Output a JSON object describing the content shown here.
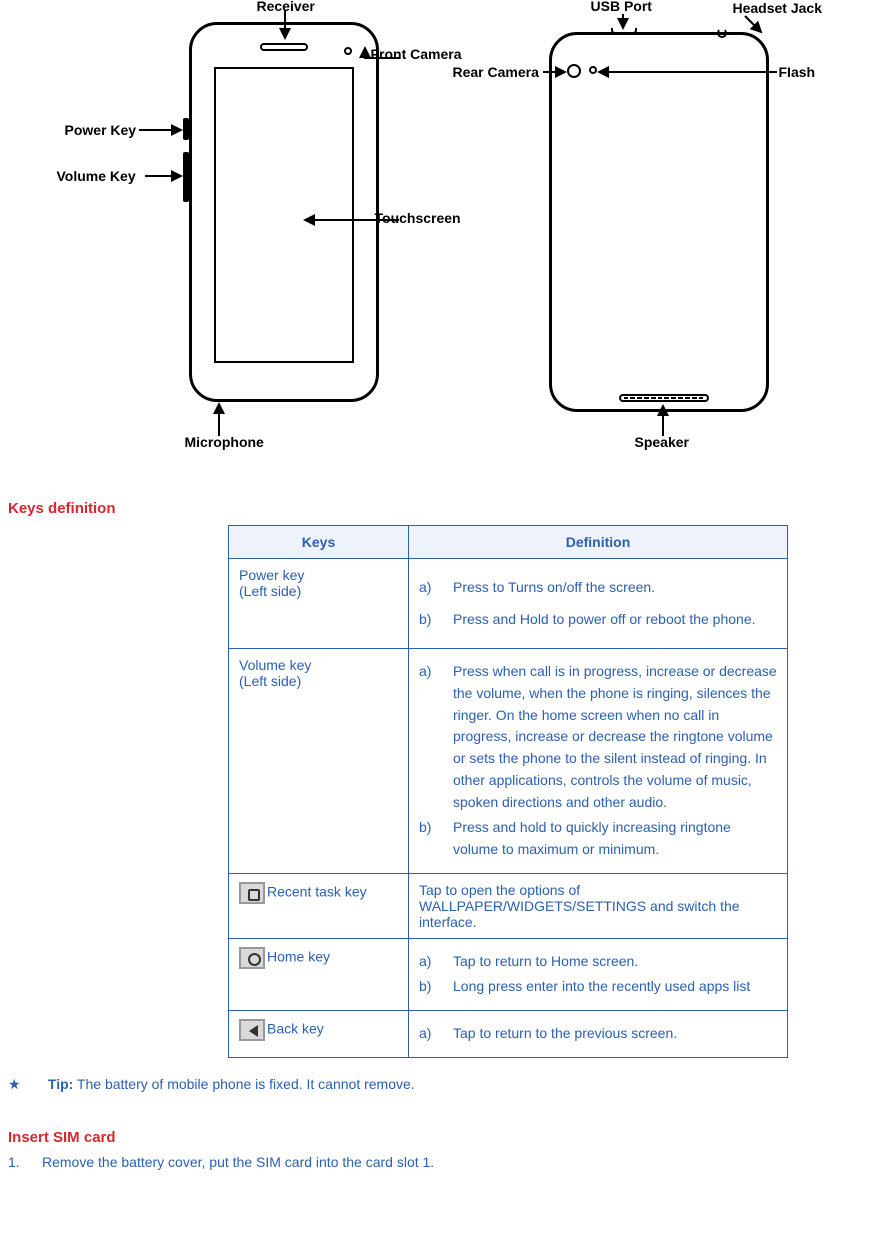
{
  "diagram": {
    "front": {
      "receiver": "Receiver",
      "front_camera": "Front Camera",
      "power_key": "Power Key",
      "volume_key": "Volume Key",
      "touchscreen": "Touchscreen",
      "microphone": "Microphone"
    },
    "back": {
      "usb_port": "USB Port",
      "headset_jack": "Headset Jack",
      "rear_camera": "Rear Camera",
      "flash": "FIash",
      "speaker": "Speaker"
    }
  },
  "sections": {
    "keys_definition": "Keys definition",
    "insert_sim": "Insert SIM card"
  },
  "table": {
    "headers": {
      "keys": "Keys",
      "definition": "Definition"
    },
    "rows": [
      {
        "key_name": "Power key",
        "key_sub": "(Left side)",
        "items": [
          {
            "m": "a)",
            "t": "Press to Turns on/off the screen."
          },
          {
            "m": "b)",
            "t": "Press and Hold to power off or reboot the phone."
          }
        ]
      },
      {
        "key_name": "Volume key",
        "key_sub": "(Left side)",
        "items": [
          {
            "m": "a)",
            "t": "Press when call is in progress, increase or decrease the volume, when the phone is ringing, silences the ringer. On the home screen when no call in progress, increase or decrease the ringtone volume or sets the phone to the silent instead of ringing. In other applications, controls the volume of music, spoken directions and other audio."
          },
          {
            "m": "b)",
            "t": "Press and hold to quickly increasing ringtone volume to maximum or minimum."
          }
        ]
      },
      {
        "icon": "square",
        "key_name": "Recent task key",
        "plain": "Tap to open the options of WALLPAPER/WIDGETS/SETTINGS and switch the interface."
      },
      {
        "icon": "circle",
        "key_name": "Home key",
        "items": [
          {
            "m": "a)",
            "t": "Tap to return to Home screen."
          },
          {
            "m": "b)",
            "t": "Long press enter into the recently used apps list"
          }
        ]
      },
      {
        "icon": "triangle",
        "key_name": "Back key",
        "items": [
          {
            "m": "a)",
            "t": "Tap to return to the previous screen."
          }
        ]
      }
    ]
  },
  "tip": {
    "star": "★",
    "label": "Tip:",
    "text": " The battery of mobile phone is fixed. It cannot remove."
  },
  "steps": [
    {
      "n": "1.",
      "t": "Remove the battery cover, put the SIM card into the card slot 1."
    }
  ]
}
